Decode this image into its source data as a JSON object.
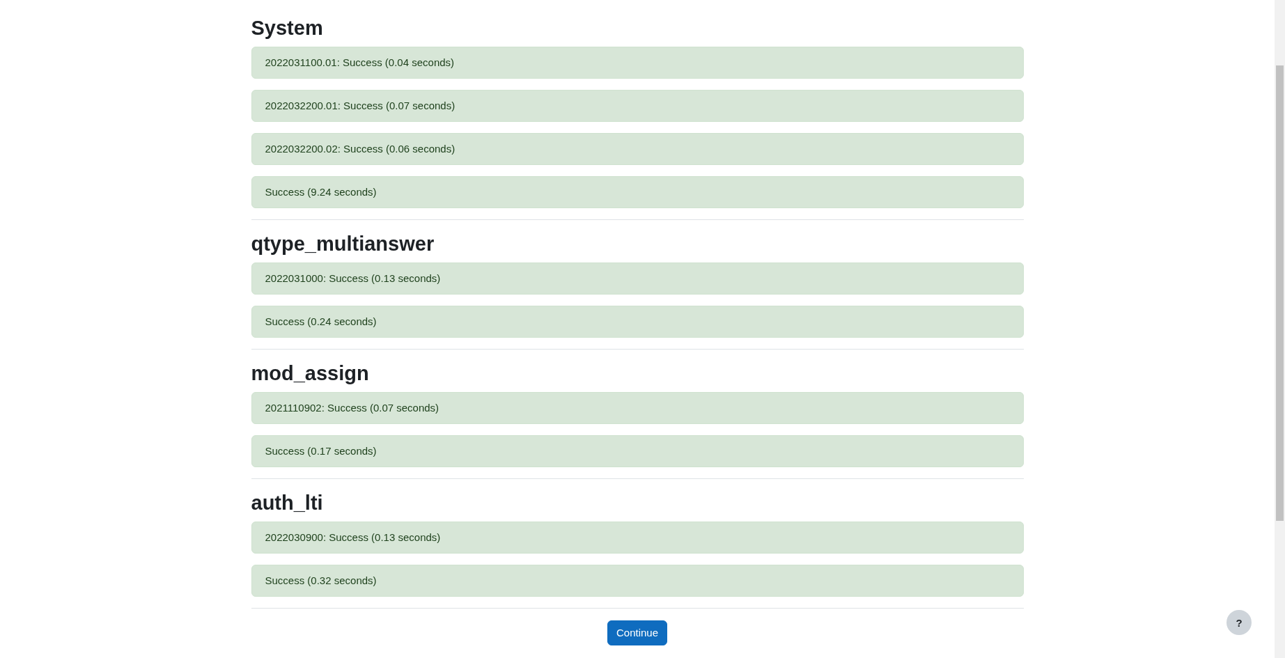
{
  "sections": [
    {
      "title": "System",
      "messages": [
        "2022031100.01: Success (0.04 seconds)",
        "2022032200.01: Success (0.07 seconds)",
        "2022032200.02: Success (0.06 seconds)",
        "Success (9.24 seconds)"
      ]
    },
    {
      "title": "qtype_multianswer",
      "messages": [
        "2022031000: Success (0.13 seconds)",
        "Success (0.24 seconds)"
      ]
    },
    {
      "title": "mod_assign",
      "messages": [
        "2021110902: Success (0.07 seconds)",
        "Success (0.17 seconds)"
      ]
    },
    {
      "title": "auth_lti",
      "messages": [
        "2022030900: Success (0.13 seconds)",
        "Success (0.32 seconds)"
      ]
    }
  ],
  "continue_button": "Continue",
  "help_button": "?"
}
